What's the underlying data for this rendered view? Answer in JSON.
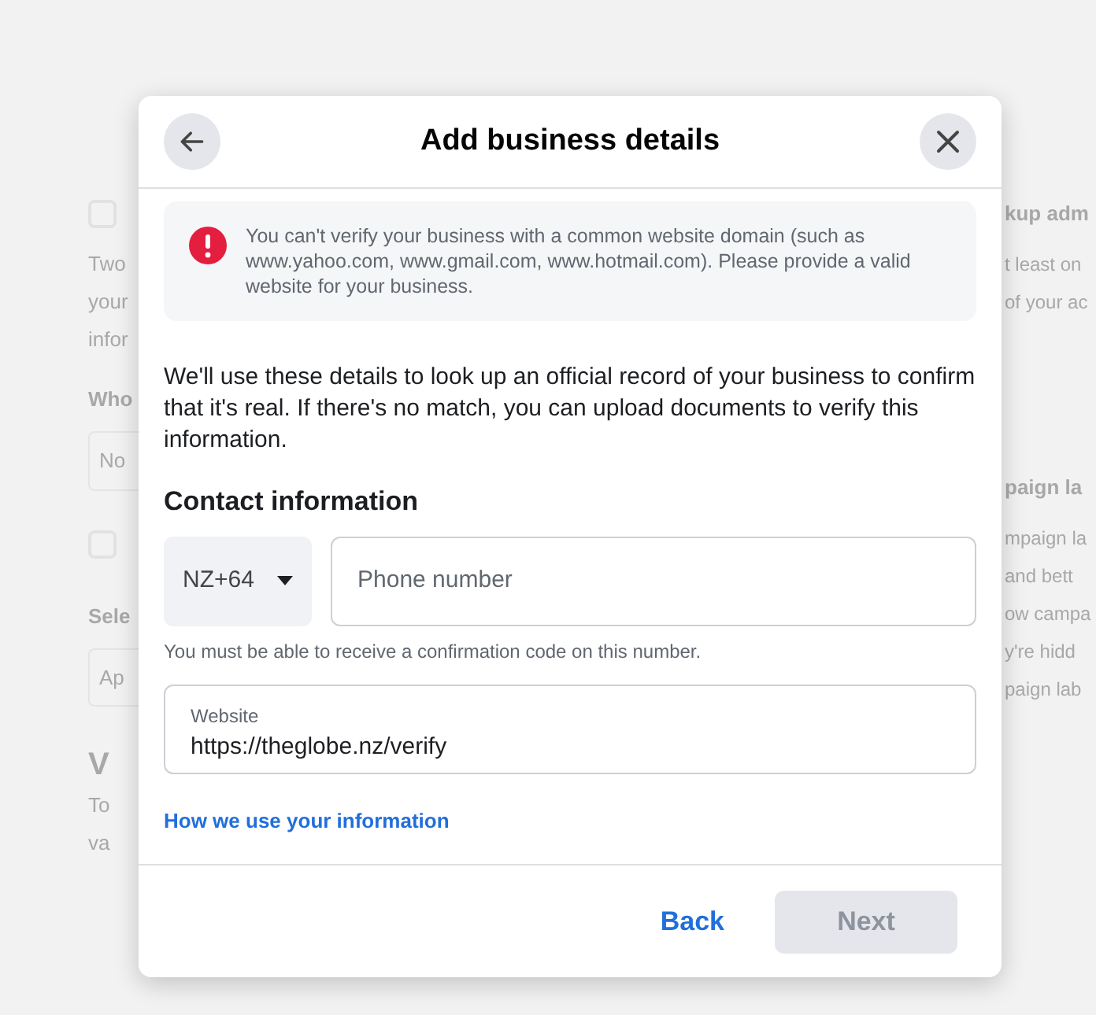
{
  "background": {
    "left": [
      {
        "kind": "icon"
      },
      {
        "kind": "text",
        "text": "Two"
      },
      {
        "kind": "text",
        "text": "your"
      },
      {
        "kind": "text",
        "text": "infor"
      },
      {
        "kind": "heading",
        "text": "Who"
      },
      {
        "kind": "field",
        "text": "No"
      },
      {
        "kind": "icon"
      },
      {
        "kind": "heading",
        "text": "Sele"
      },
      {
        "kind": "field",
        "text": "Ap"
      },
      {
        "kind": "big",
        "text": "V"
      },
      {
        "kind": "text",
        "text": "To"
      },
      {
        "kind": "text",
        "text": "va"
      }
    ],
    "right": [
      {
        "kind": "heading",
        "text": "kup adm"
      },
      {
        "kind": "text",
        "text": "t least on"
      },
      {
        "kind": "text",
        "text": "of your ac"
      },
      {
        "kind": "heading",
        "text": "paign la"
      },
      {
        "kind": "text",
        "text": "mpaign la"
      },
      {
        "kind": "text",
        "text": "and bett"
      },
      {
        "kind": "text",
        "text": "ow campa"
      },
      {
        "kind": "text",
        "text": "y're hidd"
      },
      {
        "kind": "text",
        "text": "paign lab"
      }
    ]
  },
  "dialog": {
    "title": "Add business details",
    "alert": "You can't verify your business with a common website domain (such as www.yahoo.com, www.gmail.com, www.hotmail.com). Please provide a valid website for your business.",
    "intro": "We'll use these details to look up an official record of your business to confirm that it's real. If there's no match, you can upload documents to verify this information.",
    "section": "Contact information",
    "country_code": "NZ+64",
    "phone": {
      "placeholder": "Phone number"
    },
    "phone_hint": "You must be able to receive a confirmation code on this number.",
    "website": {
      "label": "Website",
      "value": "https://theglobe.nz/verify"
    },
    "link": "How we use your information",
    "buttons": [
      {
        "label": "Back",
        "kind": "link",
        "disabled": false
      },
      {
        "label": "Next",
        "kind": "primary",
        "disabled": true
      }
    ]
  }
}
